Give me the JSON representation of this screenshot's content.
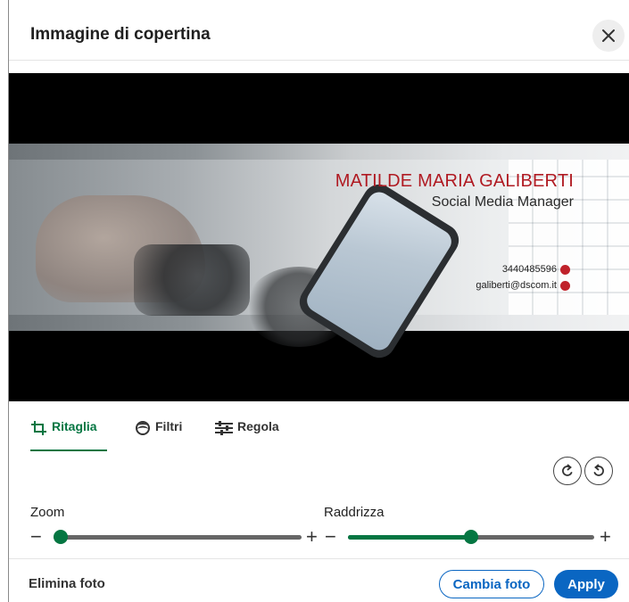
{
  "dialog": {
    "title": "Immagine di copertina",
    "close_icon": "close-icon"
  },
  "banner": {
    "name": "MATILDE MARIA GALIBERTI",
    "role": "Social Media Manager",
    "phone": "3440485596",
    "email": "galiberti@dscom.it",
    "accent_color": "#b01a22"
  },
  "tabs": [
    {
      "label": "Ritaglia",
      "icon": "crop-icon",
      "active": true
    },
    {
      "label": "Filtri",
      "icon": "filter-icon",
      "active": false
    },
    {
      "label": "Regola",
      "icon": "sliders-icon",
      "active": false
    }
  ],
  "rotate": {
    "left_icon": "rotate-left-icon",
    "right_icon": "rotate-right-icon"
  },
  "sliders": {
    "zoom": {
      "label": "Zoom",
      "value_fraction": 0.0
    },
    "straighten": {
      "label": "Raddrizza",
      "value_fraction": 0.5
    },
    "minus": "−",
    "plus": "+"
  },
  "footer": {
    "delete_label": "Elimina foto",
    "change_label": "Cambia foto",
    "apply_label": "Apply"
  },
  "colors": {
    "primary": "#0a66c2",
    "active_green": "#057642"
  }
}
